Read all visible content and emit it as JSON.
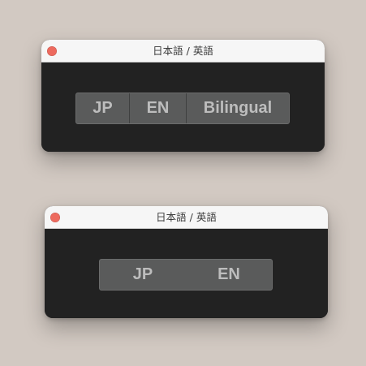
{
  "windows": [
    {
      "title": "日本語 / 英語",
      "segments": [
        "JP",
        "EN",
        "Bilingual"
      ]
    },
    {
      "title": "日本語 / 英語",
      "segments": [
        "JP",
        "EN"
      ]
    }
  ],
  "colors": {
    "desktop": "#d2c9c2",
    "window_body": "#222222",
    "titlebar": "#f6f6f6",
    "close_button": "#ed6a5e",
    "segment_bg": "#5a5b5b",
    "segment_text": "#bdbdbd"
  },
  "icons": {
    "close": "close-icon"
  }
}
